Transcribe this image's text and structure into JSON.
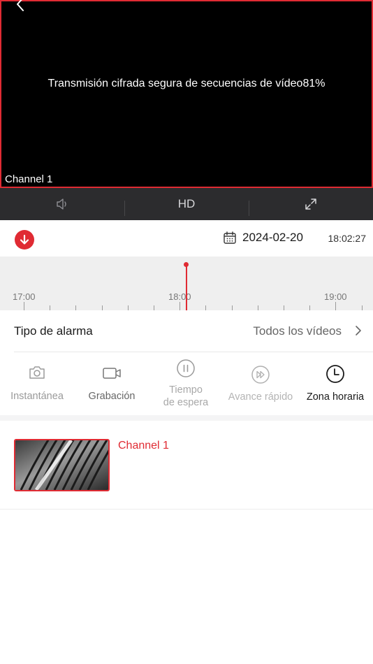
{
  "video": {
    "stream_message": "Transmisión cifrada segura de secuencias de vídeo81%",
    "channel_label": "Channel 1"
  },
  "controls": {
    "quality_label": "HD",
    "icons": [
      "volume-icon",
      "expand-icon"
    ]
  },
  "date_bar": {
    "date": "2024-02-20",
    "time": "18:02:27",
    "icons": [
      "download-icon",
      "calendar-icon"
    ]
  },
  "timeline": {
    "labels": [
      "17:00",
      "18:00",
      "19:00"
    ]
  },
  "alarm": {
    "label": "Tipo de alarma",
    "value": "Todos los vídeos"
  },
  "actions": [
    {
      "label": "Instantánea",
      "icon": "camera-icon"
    },
    {
      "label": "Grabación",
      "icon": "video-camera-icon"
    },
    {
      "label_line1": "Tiempo",
      "label_line2": "de espera",
      "icon": "pause-icon"
    },
    {
      "label": "Avance rápido",
      "icon": "fast-forward-icon"
    },
    {
      "label": "Zona horaria",
      "icon": "clock-icon"
    }
  ],
  "recordings": [
    {
      "channel": "Channel 1"
    }
  ],
  "colors": {
    "accent": "#e02b33",
    "control_bar": "#2c2c2e",
    "timeline_bg": "#efefef"
  }
}
